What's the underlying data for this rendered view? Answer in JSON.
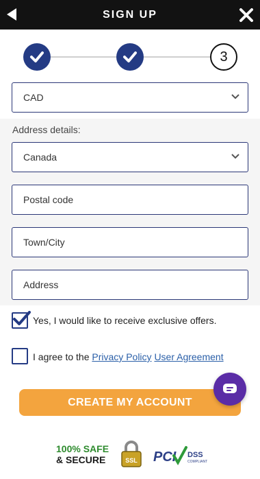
{
  "header": {
    "title": "SIGN UP",
    "back_icon": "back-arrow-icon",
    "close_icon": "close-icon"
  },
  "steps": {
    "items": [
      {
        "state": "done",
        "icon": "check-icon"
      },
      {
        "state": "done",
        "icon": "check-icon"
      },
      {
        "state": "current",
        "label": "3"
      }
    ]
  },
  "currency": {
    "value": "CAD",
    "icon": "chevron-down-icon"
  },
  "address": {
    "section_label": "Address details:",
    "country": "Canada",
    "postal_placeholder": "Postal code",
    "city_placeholder": "Town/City",
    "address_placeholder": "Address"
  },
  "consents": {
    "offers_label": "Yes, I would like to receive exclusive offers.",
    "offers_checked": true,
    "agree_prefix": "I agree to the",
    "privacy_link": "Privacy Policy",
    "agreement_link": "User Agreement",
    "agree_checked": false
  },
  "cta": {
    "label": "CREATE MY ACCOUNT"
  },
  "badges": {
    "safe_line1": "100% SAFE",
    "safe_line2": "& SECURE",
    "ssl_text": "SSL",
    "pci_text": "PCI",
    "dss_text": "DSS",
    "compliant_text": "COMPLIANT"
  },
  "colors": {
    "header_bg": "#121212",
    "step_done": "#243b84",
    "field_border": "#2a3676",
    "cta": "#f3a43e",
    "chat": "#5a2ca6",
    "link": "#2a5fa8"
  }
}
